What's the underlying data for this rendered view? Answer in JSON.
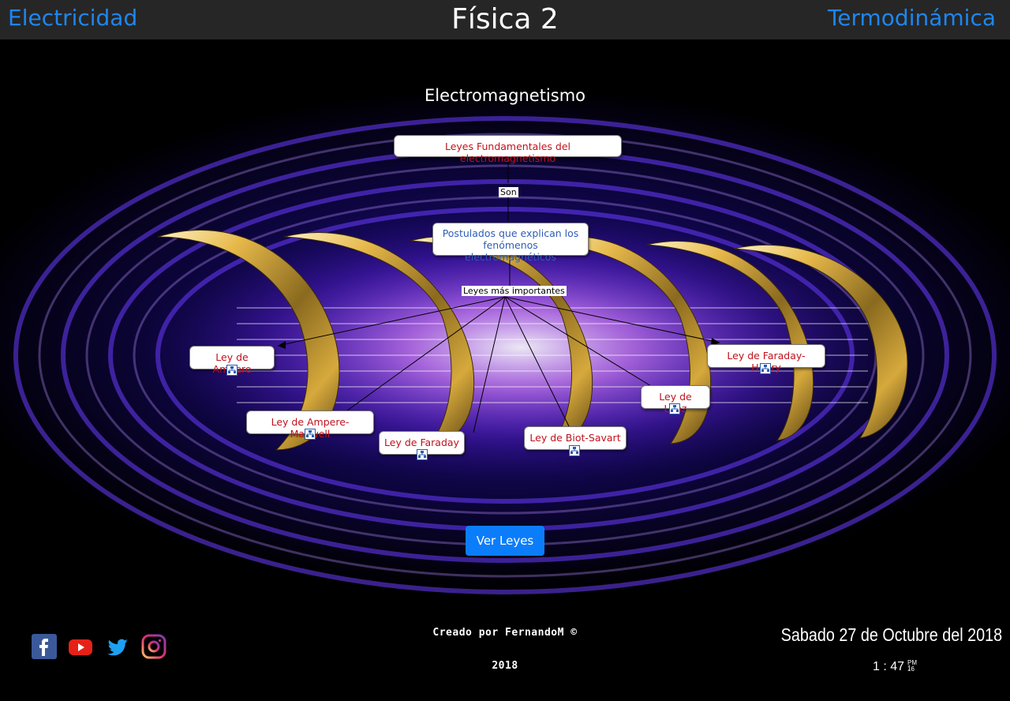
{
  "header": {
    "left_link": "Electricidad",
    "title": "Física 2",
    "right_link": "Termodinámica"
  },
  "main": {
    "section_title": "Electromagnetismo",
    "concept_map": {
      "root": "Leyes Fundamentales del electromagnetismo",
      "link1": "Son",
      "postulates_line1": "Postulados que explican los",
      "postulates_line2": "fenómenos electromagnéticos",
      "link2": "Leyes más importantes",
      "laws": [
        "Ley de Ampere",
        "Ley de Ampere-Maxwell",
        "Ley de Faraday",
        "Ley de Biot-Savart",
        "Ley de Lenz",
        "Ley de Faraday-Henry"
      ]
    },
    "button_label": "Ver Leyes"
  },
  "footer": {
    "social": [
      "facebook-icon",
      "youtube-icon",
      "twitter-icon",
      "instagram-icon"
    ],
    "credit": "Creado por FernandoM ©",
    "year": "2018",
    "date": "Sabado 27 de Octubre del 2018",
    "clock_hours": "1",
    "clock_sep": ":",
    "clock_minutes": "47",
    "clock_ampm": "PM",
    "clock_seconds": "16"
  },
  "colors": {
    "header_bg": "#262626",
    "link": "#1e86f0",
    "node_text": "#c0121d",
    "button": "#0b7dfb",
    "footer_bg": "#000000"
  }
}
